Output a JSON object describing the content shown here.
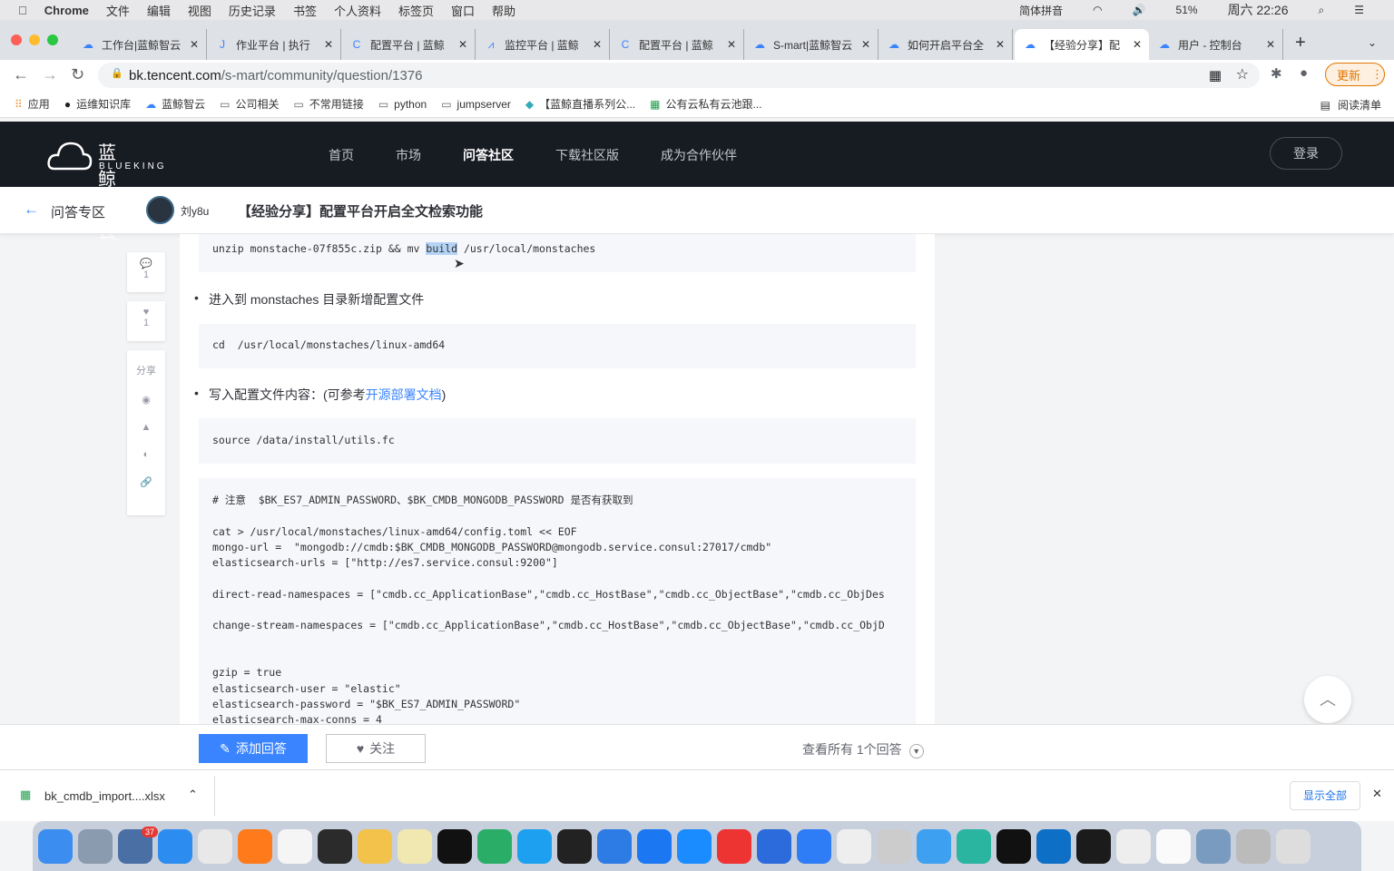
{
  "menubar": {
    "app": "Chrome",
    "items": [
      "文件",
      "编辑",
      "视图",
      "历史记录",
      "书签",
      "个人资料",
      "标签页",
      "窗口",
      "帮助"
    ],
    "input_method": "简体拼音",
    "battery": "51%",
    "clock": "周六 22:26"
  },
  "tabs": [
    {
      "title": "工作台|蓝鲸智云"
    },
    {
      "title": "作业平台 | 执行"
    },
    {
      "title": "配置平台 | 蓝鲸"
    },
    {
      "title": "监控平台 | 蓝鲸"
    },
    {
      "title": "配置平台 | 蓝鲸"
    },
    {
      "title": "S-mart|蓝鲸智云"
    },
    {
      "title": "如何开启平台全"
    },
    {
      "title": "【经验分享】配"
    },
    {
      "title": "用户 - 控制台"
    }
  ],
  "address": {
    "host": "bk.tencent.com",
    "path": "/s-mart/community/question/1376",
    "update_label": "更新"
  },
  "bookmarks": [
    "应用",
    "运维知识库",
    "蓝鲸智云",
    "公司相关",
    "不常用链接",
    "python",
    "jumpserver",
    "【蓝鲸直播系列公...",
    "公有云私有云池跟..."
  ],
  "reading_list": "阅读清单",
  "site": {
    "logo_cn": "蓝鲸智云",
    "logo_en": "BLUEKING",
    "nav": [
      "首页",
      "市场",
      "问答社区",
      "下载社区版",
      "成为合作伙伴"
    ],
    "active_nav": "问答社区",
    "login": "登录"
  },
  "subheader": {
    "back_label": "问答专区",
    "author": "刘y8u",
    "title": "【经验分享】配置平台开启全文检索功能"
  },
  "side": {
    "comments": "1",
    "likes": "1",
    "share": "分享"
  },
  "article": {
    "code1": {
      "before": "unzip monstache-07f855c.zip && mv ",
      "selected": "build",
      "after": " /usr/local/monstaches"
    },
    "bullet1": "进入到 monstaches 目录新增配置文件",
    "code2": "cd  /usr/local/monstaches/linux-amd64",
    "bullet2_prefix": "写入配置文件内容：(可参考",
    "bullet2_link": "开源部署文档",
    "bullet2_suffix": ")",
    "code3": "source /data/install/utils.fc",
    "code4": [
      "# 注意  $BK_ES7_ADMIN_PASSWORD、$BK_CMDB_MONGODB_PASSWORD 是否有获取到",
      "",
      "cat > /usr/local/monstaches/linux-amd64/config.toml << EOF",
      "mongo-url =  \"mongodb://cmdb:$BK_CMDB_MONGODB_PASSWORD@mongodb.service.consul:27017/cmdb\"",
      "elasticsearch-urls = [\"http://es7.service.consul:9200\"]",
      "",
      "direct-read-namespaces = [\"cmdb.cc_ApplicationBase\",\"cmdb.cc_HostBase\",\"cmdb.cc_ObjectBase\",\"cmdb.cc_ObjDes",
      "",
      "change-stream-namespaces = [\"cmdb.cc_ApplicationBase\",\"cmdb.cc_HostBase\",\"cmdb.cc_ObjectBase\",\"cmdb.cc_ObjD",
      "",
      "",
      "gzip = true",
      "elasticsearch-user = \"elastic\"",
      "elasticsearch-password = \"$BK_ES7_ADMIN_PASSWORD\"",
      "elasticsearch-max-conns = 4"
    ]
  },
  "bottom": {
    "answer": "添加回答",
    "follow": "关注",
    "view_all": "查看所有 1个回答"
  },
  "download": {
    "file": "bk_cmdb_import....xlsx",
    "show_all": "显示全部"
  },
  "dock": {
    "badge": "37"
  },
  "colors": {
    "accent": "#3a84ff",
    "nav_bg": "#171b22"
  }
}
